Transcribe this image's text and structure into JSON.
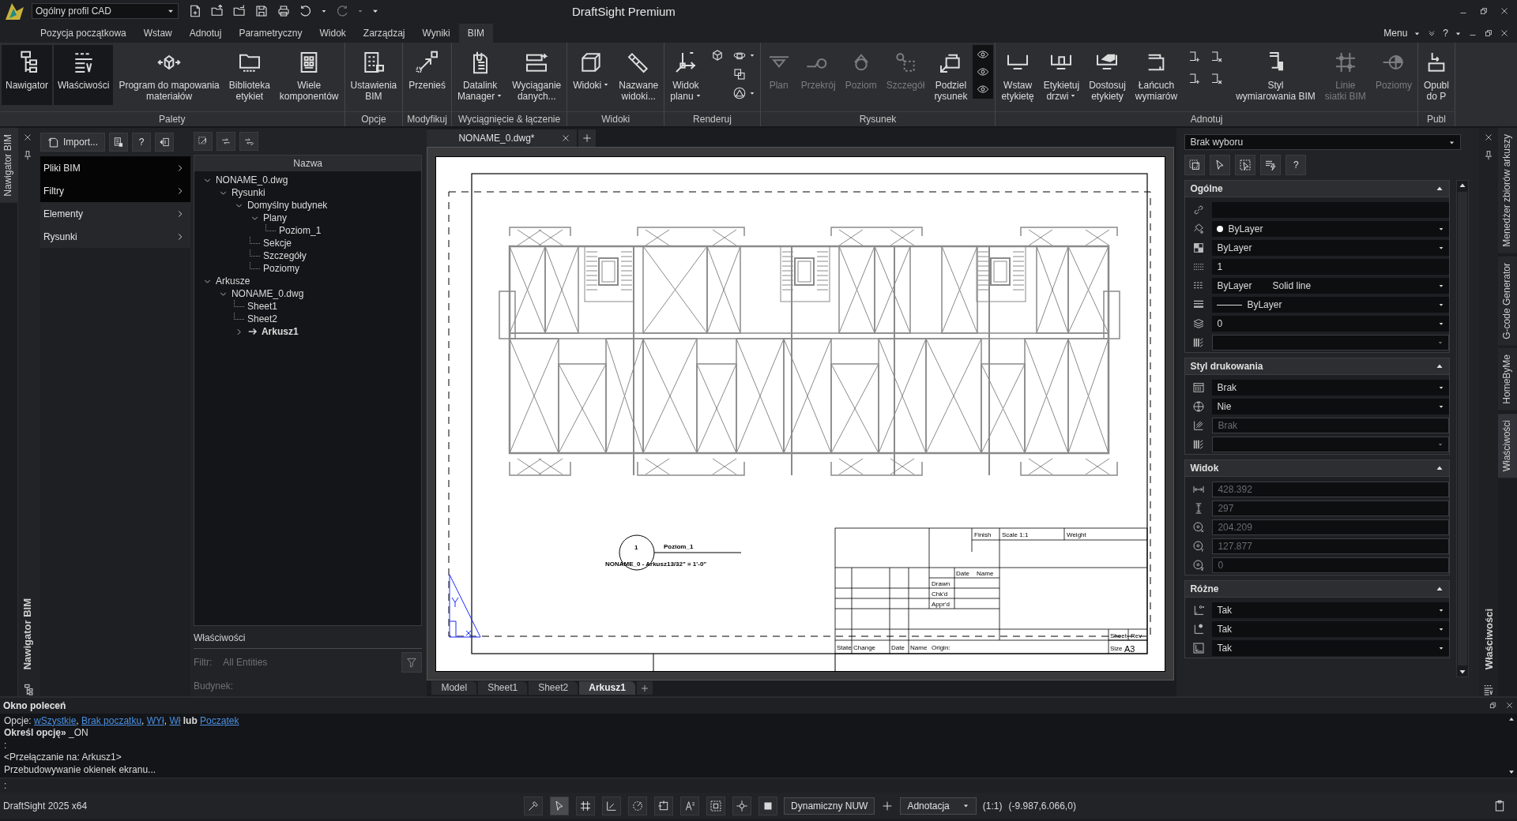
{
  "title_bar": {
    "profile": "Ogólny profil CAD",
    "title": "DraftSight Premium"
  },
  "ribbon_tabs": [
    {
      "label": "Pozycja początkowa",
      "selected": false
    },
    {
      "label": "Wstaw",
      "selected": false
    },
    {
      "label": "Adnotuj",
      "selected": false
    },
    {
      "label": "Parametryczny",
      "selected": false
    },
    {
      "label": "Widok",
      "selected": false
    },
    {
      "label": "Zarządzaj",
      "selected": false
    },
    {
      "label": "Wyniki",
      "selected": false
    },
    {
      "label": "BIM",
      "selected": true
    }
  ],
  "ribbon_menu": {
    "menu": "Menu",
    "help": "?"
  },
  "ribbon": {
    "groups": [
      {
        "label": "Palety",
        "buttons": [
          {
            "kind": "large",
            "label": "Nawigator",
            "selected": true,
            "disabled": false,
            "dropdown": false
          },
          {
            "kind": "large",
            "label": "Właściwości",
            "selected": true,
            "disabled": false,
            "dropdown": false
          },
          {
            "kind": "large",
            "label": "Program do mapowania\nmateriałów",
            "selected": false,
            "disabled": false,
            "dropdown": false
          },
          {
            "kind": "large",
            "label": "Biblioteka\netykiet",
            "selected": false,
            "disabled": false,
            "dropdown": false
          },
          {
            "kind": "large",
            "label": "Wiele\nkomponentów",
            "selected": false,
            "disabled": false,
            "dropdown": false
          }
        ]
      },
      {
        "label": "Opcje",
        "buttons": [
          {
            "kind": "large",
            "label": "Ustawienia\nBIM",
            "selected": false,
            "disabled": false,
            "dropdown": false
          }
        ]
      },
      {
        "label": "Modyfikuj",
        "buttons": [
          {
            "kind": "large",
            "label": "Przenieś",
            "selected": false,
            "disabled": false,
            "dropdown": false
          }
        ]
      },
      {
        "label": "Wyciągnięcie & łączenie",
        "buttons": [
          {
            "kind": "large",
            "label": "Datalink\nManager",
            "selected": false,
            "disabled": false,
            "dropdown": true
          },
          {
            "kind": "large",
            "label": "Wyciąganie\ndanych...",
            "selected": false,
            "disabled": false,
            "dropdown": false
          }
        ]
      },
      {
        "label": "Widoki",
        "buttons": [
          {
            "kind": "large",
            "label": "Widoki",
            "selected": false,
            "disabled": false,
            "dropdown": true
          },
          {
            "kind": "large",
            "label": "Nazwane\nwidoki...",
            "selected": false,
            "disabled": false,
            "dropdown": false
          }
        ]
      },
      {
        "label": "Renderuj",
        "buttons": [
          {
            "kind": "large",
            "label": "Widok\nplanu",
            "selected": false,
            "disabled": false,
            "dropdown": true
          },
          {
            "kind": "icon_column"
          }
        ]
      },
      {
        "label": "Rysunek",
        "buttons": [
          {
            "kind": "large",
            "label": "Plan",
            "selected": false,
            "disabled": true,
            "dropdown": false
          },
          {
            "kind": "large",
            "label": "Przekrój",
            "selected": false,
            "disabled": true,
            "dropdown": false
          },
          {
            "kind": "large",
            "label": "Poziom",
            "selected": false,
            "disabled": true,
            "dropdown": false
          },
          {
            "kind": "large",
            "label": "Szczegół",
            "selected": false,
            "disabled": true,
            "dropdown": false
          },
          {
            "kind": "large",
            "label": "Podziel\nrysunek",
            "selected": false,
            "disabled": false,
            "dropdown": false
          },
          {
            "kind": "icon_column"
          }
        ]
      },
      {
        "label": "Adnotuj",
        "buttons": [
          {
            "kind": "large",
            "label": "Wstaw\netykietę",
            "selected": false,
            "disabled": false,
            "dropdown": false
          },
          {
            "kind": "large",
            "label": "Etykietuj\ndrzwi",
            "selected": false,
            "disabled": false,
            "dropdown": true
          },
          {
            "kind": "large",
            "label": "Dostosuj\netykiety",
            "selected": false,
            "disabled": false,
            "dropdown": false
          },
          {
            "kind": "large",
            "label": "Łańcuch\nwymiarów",
            "selected": false,
            "disabled": false,
            "dropdown": false
          },
          {
            "kind": "icon_grid"
          },
          {
            "kind": "large",
            "label": "Styl\nwymiarowania BIM",
            "selected": false,
            "disabled": false,
            "dropdown": false
          },
          {
            "kind": "large",
            "label": "Linie\nsiatki BIM",
            "selected": false,
            "disabled": true,
            "dropdown": false
          },
          {
            "kind": "large",
            "label": "Poziomy",
            "selected": false,
            "disabled": true,
            "dropdown": false
          }
        ]
      },
      {
        "label": "Publ",
        "buttons": [
          {
            "kind": "large",
            "label": "Opubl\ndo P",
            "selected": false,
            "disabled": false,
            "dropdown": false
          }
        ]
      }
    ]
  },
  "bim_navigator": {
    "side_tab": {
      "label": "Nawigator BIM",
      "selected": true
    },
    "panel_title": "Nawigator BIM",
    "import_button": "Import...",
    "help_button": "?",
    "categories": [
      {
        "label": "Pliki BIM",
        "highlighted": true
      },
      {
        "label": "Filtry",
        "highlighted": true
      },
      {
        "label": "Elementy",
        "highlighted": false
      },
      {
        "label": "Rysunki",
        "highlighted": false
      }
    ],
    "tree_header": "Nazwa",
    "tree": [
      {
        "label": "NONAME_0.dwg",
        "expanded": true,
        "current": false,
        "children": [
          {
            "label": "Rysunki",
            "expanded": true,
            "current": false,
            "children": [
              {
                "label": "Domyślny budynek",
                "expanded": true,
                "current": false,
                "children": [
                  {
                    "label": "Plany",
                    "expanded": true,
                    "current": false,
                    "children": [
                      {
                        "label": "Poziom_1",
                        "current": false
                      }
                    ]
                  },
                  {
                    "label": "Sekcje",
                    "current": false
                  },
                  {
                    "label": "Szczegóły",
                    "current": false
                  },
                  {
                    "label": "Poziomy",
                    "current": false
                  }
                ]
              }
            ]
          }
        ]
      },
      {
        "label": "Arkusze",
        "expanded": true,
        "current": false,
        "children": [
          {
            "label": "NONAME_0.dwg",
            "expanded": true,
            "current": false,
            "children": [
              {
                "label": "Sheet1",
                "current": false
              },
              {
                "label": "Sheet2",
                "current": false
              },
              {
                "label": "Arkusz1",
                "expanded": false,
                "current": true
              }
            ]
          }
        ]
      }
    ],
    "properties": {
      "title": "Właściwości",
      "filter_label": "Filtr:",
      "filter_value": "All Entities",
      "building_label": "Budynek:"
    }
  },
  "document_tabs": [
    {
      "label": "NONAME_0.dwg*",
      "selected": true
    }
  ],
  "sheet": {
    "view_number": "1",
    "view_name": "Poziom_1",
    "view_caption": "NONAME_0 - Arkusz13/32\" = 1'-0\"",
    "title_block": [
      "Finish",
      "Scale 1:1",
      "Weight",
      "Date",
      "Name",
      "Drawn",
      "Chk'd",
      "Appr'd",
      "Sheet",
      "Rev",
      "State",
      "Change",
      "Date",
      "Name",
      "Origin:",
      "Size",
      "A3"
    ]
  },
  "layout_tabs": [
    {
      "label": "Model",
      "selected": false
    },
    {
      "label": "Sheet1",
      "selected": false
    },
    {
      "label": "Sheet2",
      "selected": false
    },
    {
      "label": "Arkusz1",
      "selected": true
    }
  ],
  "properties_panel": {
    "selection": "Brak wyboru",
    "help_button": "?",
    "panel_title": "Właściwości",
    "sections": [
      {
        "title": "Ogólne",
        "expanded": true,
        "rows": [
          {
            "kind": "text",
            "disabled": false
          },
          {
            "kind": "color_dropdown",
            "value": "ByLayer",
            "disabled": false
          },
          {
            "kind": "dropdown",
            "value": "ByLayer",
            "disabled": false
          },
          {
            "kind": "text",
            "value": "1",
            "disabled": false
          },
          {
            "kind": "double_dropdown",
            "value": "ByLayer",
            "value2": "Solid line",
            "disabled": false
          },
          {
            "kind": "line_dropdown",
            "value": "ByLayer",
            "disabled": false
          },
          {
            "kind": "dropdown",
            "value": "0",
            "disabled": false
          },
          {
            "kind": "dropdown",
            "disabled": true
          }
        ]
      },
      {
        "title": "Styl drukowania",
        "expanded": true,
        "rows": [
          {
            "kind": "dropdown",
            "value": "Brak",
            "disabled": false
          },
          {
            "kind": "dropdown",
            "value": "Nie",
            "disabled": false
          },
          {
            "kind": "text",
            "value": "Brak",
            "disabled": true
          },
          {
            "kind": "dropdown",
            "disabled": true
          }
        ]
      },
      {
        "title": "Widok",
        "expanded": true,
        "rows": [
          {
            "kind": "text",
            "value": "428.392",
            "disabled": true
          },
          {
            "kind": "text",
            "value": "297",
            "disabled": true
          },
          {
            "kind": "text",
            "value": "204.209",
            "disabled": true
          },
          {
            "kind": "text",
            "value": "127.877",
            "disabled": true
          },
          {
            "kind": "text",
            "value": "0",
            "disabled": true
          }
        ]
      },
      {
        "title": "Różne",
        "expanded": true,
        "rows": [
          {
            "kind": "dropdown",
            "value": "Tak",
            "disabled": false
          },
          {
            "kind": "dropdown",
            "value": "Tak",
            "disabled": false
          },
          {
            "kind": "dropdown",
            "value": "Tak",
            "disabled": false
          }
        ]
      }
    ]
  },
  "side_tabs_right": [
    {
      "label": "Menedżer zbiorów arkuszy",
      "selected": false
    },
    {
      "label": "G-code Generator",
      "selected": false
    },
    {
      "label": "HomeByMe",
      "selected": false
    },
    {
      "label": "Właściwości",
      "selected": true
    }
  ],
  "command_window": {
    "title": "Okno poleceń",
    "prompt": ":",
    "lines": [
      [
        {
          "kind": "text",
          "text": "Opcje: "
        },
        {
          "kind": "link",
          "text": "wSzystkie"
        },
        {
          "kind": "text",
          "text": ", "
        },
        {
          "kind": "link",
          "text": "Brak początku"
        },
        {
          "kind": "text",
          "text": ", "
        },
        {
          "kind": "link",
          "text": "WYł"
        },
        {
          "kind": "text",
          "text": ", "
        },
        {
          "kind": "link",
          "text": "Wł"
        },
        {
          "kind": "bold",
          "text": " lub "
        },
        {
          "kind": "link",
          "text": "Początek"
        }
      ],
      [
        {
          "kind": "bold",
          "text": "Określ opcję»"
        },
        {
          "kind": "text",
          "text": " _ON"
        }
      ],
      [
        {
          "kind": "text",
          "text": ":"
        }
      ],
      [
        {
          "kind": "text",
          "text": "<Przełączanie na: Arkusz1>"
        }
      ],
      [
        {
          "kind": "text",
          "text": "Przebudowywanie okienek ekranu..."
        }
      ]
    ]
  },
  "status_bar": {
    "product": "DraftSight 2025 x64",
    "coordinate_system": "Dynamiczny NUW",
    "annotation": "Adnotacja",
    "scale": "(1:1)",
    "coordinates": "(-9.987,6.066,0)"
  }
}
